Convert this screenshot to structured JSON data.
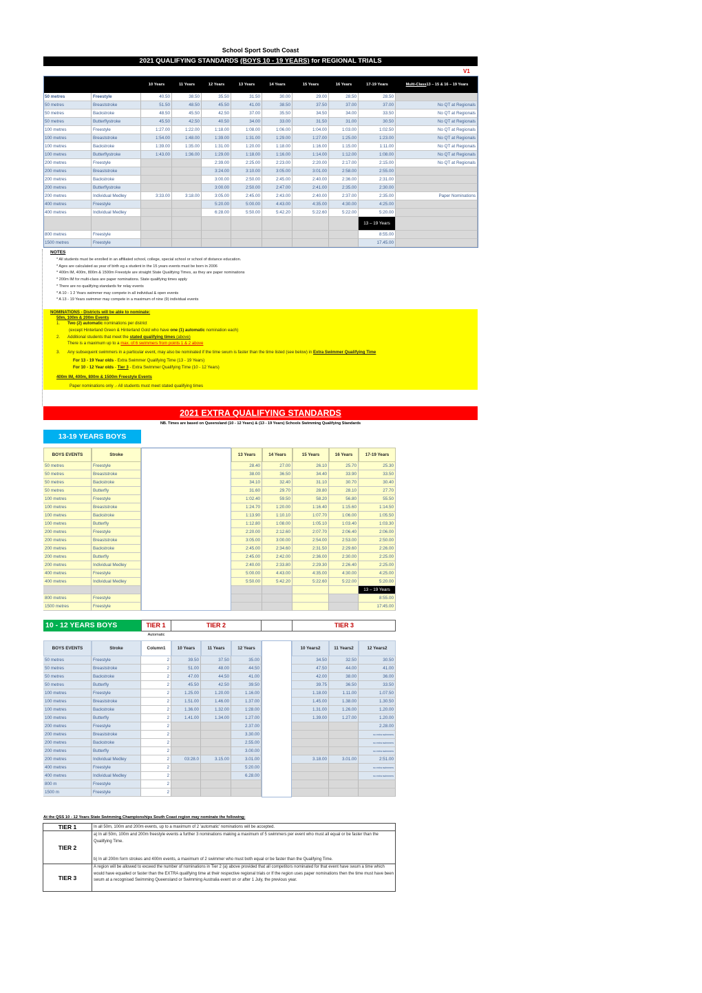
{
  "header": {
    "org": "School Sport South Coast",
    "title_pre": "2021  QUALIFYING STANDARDS ",
    "title_u": "(BOYS 10 - 19 YEARS)",
    "title_post": " for REGIONAL TRIALS",
    "version": "V1"
  },
  "t1": {
    "headers": [
      "",
      "",
      "10 Years",
      "11 Years",
      "12 Years",
      "13 Years",
      "14 Years",
      "15 Years",
      "16 Years",
      "17-19 Years"
    ],
    "multi_u": "Multi-Class",
    "multi_rest": "  13 – 15 & 16 – 19 Years",
    "rows": [
      [
        "50 metres",
        "Freestyle",
        "40.50",
        "38.50",
        "35.50",
        "31.50",
        "30.00",
        "29.00",
        "28.50",
        "28.50",
        null
      ],
      [
        "50 metres",
        "Breaststroke",
        "51.50",
        "48.50",
        "45.50",
        "41.00",
        "38.50",
        "37.50",
        "37.00",
        "37.00",
        "No QT at Regionals"
      ],
      [
        "50 metres",
        "Backstroke",
        "48.50",
        "45.50",
        "42.50",
        "37.00",
        "35.50",
        "34.50",
        "34.00",
        "33.50",
        "No QT at Regionals"
      ],
      [
        "50 metres",
        "Butterflystroke",
        "45.50",
        "42.50",
        "40.50",
        "34.00",
        "33.00",
        "31.50",
        "31.00",
        "30.50",
        "No QT at Regionals"
      ],
      [
        "100 metres",
        "Freestyle",
        "1:27.00",
        "1:22.00",
        "1:18.00",
        "1:08.00",
        "1:06.00",
        "1:04.00",
        "1:03.00",
        "1:02.50",
        "No QT at Regionals"
      ],
      [
        "100 metres",
        "Breaststroke",
        "1:54.00",
        "1:48.00",
        "1:39.00",
        "1:31.00",
        "1:29.00",
        "1:27.00",
        "1:25.00",
        "1:23.00",
        "No QT at Regionals"
      ],
      [
        "100 metres",
        "Backstroke",
        "1:39.00",
        "1:35.00",
        "1:31.00",
        "1:20.00",
        "1:18.00",
        "1:16.00",
        "1:15.00",
        "1:11.00",
        "No QT at Regionals"
      ],
      [
        "100 metres",
        "Butterflystroke",
        "1:43.00",
        "1:36.00",
        "1:29.00",
        "1:18.00",
        "1:16.00",
        "1:14.00",
        "1:12.00",
        "1:08.00",
        "No QT at Regionals"
      ],
      [
        "200 metres",
        "Freestyle",
        null,
        null,
        "2:39.00",
        "2:25.00",
        "2:23.00",
        "2:20.00",
        "2:17.00",
        "2:15.00",
        "No QT at Regionals"
      ],
      [
        "200 metres",
        "Breaststroke",
        null,
        null,
        "3:24.00",
        "3:10.00",
        "3:05.00",
        "3:01.00",
        "2:58.00",
        "2:55.00",
        null
      ],
      [
        "200 metres",
        "Backstroke",
        null,
        null,
        "3:00.00",
        "2:50.00",
        "2:45.00",
        "2:40.00",
        "2:36.00",
        "2:31.00",
        null
      ],
      [
        "200 metres",
        "Butterflystroke",
        null,
        null,
        "3:00.00",
        "2:50.00",
        "2:47.00",
        "2:41.00",
        "2:35.00",
        "2:30.00",
        null
      ],
      [
        "200 metres",
        "Individual Medley",
        "3:33.00",
        "3:18.00",
        "3:05.00",
        "2:45.00",
        "2:43.00",
        "2:40.00",
        "2:37.00",
        "2:35.00",
        "Paper Nominations"
      ],
      [
        "400 metres",
        "Freestyle",
        null,
        null,
        "5:20.00",
        "5:00.00",
        "4:43.00",
        "4:35.00",
        "4:30.00",
        "4:25.00",
        null
      ],
      [
        "400 metres",
        "Individual Medley",
        null,
        null,
        "6:28.00",
        "5:50.00",
        "5:42.20",
        "5:22.60",
        "5:22.00",
        "5:20.00",
        null
      ],
      [
        null,
        null,
        null,
        null,
        null,
        null,
        null,
        null,
        null,
        "13 – 19 Years",
        null
      ],
      [
        "800 metres",
        "Freestyle",
        null,
        null,
        null,
        null,
        null,
        null,
        null,
        "8:55.00",
        null
      ],
      [
        "1500 metres",
        "Freestyle",
        null,
        null,
        null,
        null,
        null,
        null,
        null,
        "17.45.00",
        null
      ]
    ]
  },
  "notes": {
    "title": "NOTES",
    "items": [
      "* All students must be enrolled in an affiliated school, college, special school or school of distance education.",
      "* Ages are calculated as year of birth eg a student in the 15 years events must be born in 2006",
      "* 400m IM, 400m, 800m & 1500m Freestyle are straight State Qualifying Times, as they are paper nominations",
      "* 200m IM for multi-class are paper nominations. State qualifying times apply",
      "* There are no qualifying standards for relay events",
      "* A 10 - 1 2 Years swimmer may compete in all individual & open events",
      "* A 13 - 19 Years swimmer may compete in a maximum of nine (9) individual events"
    ]
  },
  "nominations": {
    "title": "NOMINATIONS - Districts will be able to nominate:",
    "sub1": "50m, 100m & 200m Events",
    "p1_num": "1.",
    "p1_b": "Two (2)  automatic",
    "p1_rest": " nominations per district",
    "p1b_a": "(except Hinterland Green & Hinterland Gold who have ",
    "p1b_b": "one (1)  automatic",
    "p1b_c": " nomination each)",
    "p2_num": "2.",
    "p2_a": "Additional students that meet the ",
    "p2_b": "stated qualifying times",
    "p2_c": " (above)",
    "p2b_a": "There is a maximum up to a ",
    "p2b_red": "max. of 6 swimmers from points 1 & 2 above",
    "p3_num": "3.",
    "p3_a": "Any subsequent swimmers in a particular event, may also be nominated if the time swum is faster than the time listed (see below) in ",
    "p3_b": "Extra Swimmer Qualifying Time",
    "l13_b": "For 13 - 19 Year olds",
    "l13_rest": "  - Extra Swimmer Qualifying Time  (13 - 19 Years)",
    "l10_b": "For 10 - 12 Year olds",
    "l10_mid": "  - ",
    "l10_tier": "Tier 3",
    "l10_rest": " - Extra Swimmer Qualifying Time  (10 - 12 Years)",
    "sub2": "400m IM, 400m, 800m & 1500m Freestyle Events",
    "paper": "Paper nominations only .-   All students must meet stated qualifying times"
  },
  "extra": {
    "banner": "2021 EXTRA QUALIFYING STANDARDS",
    "nb": "NB. Times are based on Queensland (10 - 12 Years) & (13 - 19 Years) Schools Swimming Qualifying Standards"
  },
  "t2": {
    "label": "13-19 YEARS BOYS",
    "headers": [
      "BOYS EVENTS",
      "Stroke",
      "13 Years",
      "14 Years",
      "15 Years",
      "16 Years",
      "17-19 Years"
    ],
    "rows": [
      [
        "50 metres",
        "Freestyle",
        "28.40",
        "27.00",
        "26.10",
        "25.70",
        "25.30"
      ],
      [
        "50 metres",
        "Breaststroke",
        "38.00",
        "36.50",
        "34.40",
        "33.90",
        "33.50"
      ],
      [
        "50 metres",
        "Backstroke",
        "34.10",
        "32.40",
        "31.10",
        "30.70",
        "30.40"
      ],
      [
        "50 metres",
        "Butterfly",
        "31.60",
        "29.70",
        "28.80",
        "28.10",
        "27.70"
      ],
      [
        "100 metres",
        "Freestyle",
        "1:02.40",
        "59.50",
        "58.20",
        "56.80",
        "55.50"
      ],
      [
        "100 metres",
        "Breaststroke",
        "1:24.70",
        "1:20.00",
        "1:16.40",
        "1:15.60",
        "1:14.50"
      ],
      [
        "100 metres",
        "Backstroke",
        "1:13.90",
        "1:10.10",
        "1:07.70",
        "1:06.00",
        "1:05.50"
      ],
      [
        "100 metres",
        "Butterfly",
        "1:12.80",
        "1:08.00",
        "1:05.10",
        "1:03.40",
        "1:03.30"
      ],
      [
        "200 metres",
        "Freestyle",
        "2:20.00",
        "2:12.60",
        "2:07.70",
        "2:06.40",
        "2:06.00"
      ],
      [
        "200 metres",
        "Breaststroke",
        "3:05.00",
        "3:00.00",
        "2:54.00",
        "2:53.00",
        "2:50.00"
      ],
      [
        "200 metres",
        "Backstroke",
        "2:45.00",
        "2:34.60",
        "2:31.50",
        "2:29.60",
        "2:26.00"
      ],
      [
        "200 metres",
        "Butterfly",
        "2:45.00",
        "2:42.00",
        "2:36.00",
        "2:30.00",
        "2:25.00"
      ],
      [
        "200 metres",
        "Individual Medley",
        "2:40.00",
        "2:33.80",
        "2:29.30",
        "2:26.40",
        "2:25.00"
      ],
      [
        "400 metres",
        "Freestyle",
        "5:00.00",
        "4:43.00",
        "4:35.00",
        "4:30.00",
        "4:25.00"
      ],
      [
        "400 metres",
        "Individual Medley",
        "5:50.00",
        "5:42.20",
        "5:22.60",
        "5:22.00",
        "5:20.00"
      ],
      [
        null,
        null,
        null,
        null,
        "",
        "",
        "13 – 19 Years"
      ],
      [
        "800 metres",
        "Freestyle",
        null,
        null,
        "",
        null,
        "8:55.00"
      ],
      [
        "1500 metres",
        "Freestyle",
        null,
        null,
        "",
        null,
        "17:45.00"
      ]
    ]
  },
  "t3": {
    "label": "10 - 12 YEARS BOYS",
    "tier1": "TIER 1",
    "tier2": "TIER 2",
    "tier3": "TIER 3",
    "automatic": "Automatic",
    "headers": [
      "BOYS EVENTS",
      "Stroke",
      "Column1",
      "10 Years",
      "11 Years",
      "12 Years",
      "10 Years2",
      "11 Years2",
      "12 Years2"
    ],
    "rows": [
      [
        "50 metres",
        "Freestyle",
        "2",
        "39.50",
        "37.50",
        "35.00",
        "34.50",
        "32.50",
        "30.50"
      ],
      [
        "50 metres",
        "Breaststroke",
        "2",
        "51.00",
        "48.00",
        "44.50",
        "47.50",
        "44.00",
        "41.00"
      ],
      [
        "50 metres",
        "Backstroke",
        "2",
        "47.00",
        "44.50",
        "41.00",
        "42.00",
        "38.00",
        "36.00"
      ],
      [
        "50 metres",
        "Butterfly",
        "2",
        "45.50",
        "42.50",
        "39.50",
        "39.75",
        "36.50",
        "33.50"
      ],
      [
        "100 metres",
        "Freestyle",
        "2",
        "1.25.00",
        "1.20.00",
        "1.16.00",
        "1.18.00",
        "1.11.00",
        "1.07.50"
      ],
      [
        "100 metres",
        "Breaststroke",
        "2",
        "1.51.00",
        "1.46.00",
        "1.37.00",
        "1.45.00",
        "1.38.00",
        "1.30.50"
      ],
      [
        "100 metres",
        "Backstroke",
        "2",
        "1.36.00",
        "1.32.00",
        "1:28.00",
        "1.31.00",
        "1.26.00",
        "1.20.00"
      ],
      [
        "100 metres",
        "Butterfly",
        "2",
        "1.41.00",
        "1.34.00",
        "1.27.00",
        "1.39.00",
        "1.27.00",
        "1.20.00"
      ],
      [
        "200 metres",
        "Freestyle",
        "2",
        null,
        null,
        "2.37.00",
        null,
        null,
        "2.28.00"
      ],
      [
        "200 metres",
        "Breaststroke",
        "2",
        null,
        null,
        "3.30.00",
        null,
        null,
        "no extra swimmers"
      ],
      [
        "200 metres",
        "Backstroke",
        "2",
        null,
        null,
        "2.55.00",
        null,
        null,
        "no extra swimmers"
      ],
      [
        "200 metres",
        "Butterfly",
        "2",
        null,
        null,
        "3.00.00",
        null,
        null,
        "no extra swimmers"
      ],
      [
        "200 metres",
        "Individual Medley",
        "2",
        "03:28.0",
        "3.15.00",
        "3.01.00",
        "3.18.00",
        "3.01.00",
        "2:51.00"
      ],
      [
        "400 metres",
        "Freestyle",
        "2",
        null,
        null,
        "5:20.00",
        null,
        null,
        "no extra swimmers"
      ],
      [
        "400 metres",
        "Individual Medley",
        "2",
        null,
        null,
        "6.28.00",
        null,
        null,
        "no extra swimmers"
      ],
      [
        "800 m",
        "Freestyle",
        "2",
        null,
        null,
        null,
        null,
        null,
        null
      ],
      [
        "1500 m",
        "Freestyle",
        "2",
        null,
        null,
        null,
        null,
        null,
        null
      ]
    ]
  },
  "tiers": {
    "heading": "At the QSS 10 - 12 Years State Swimming Championships South Coast region may nominate the following:",
    "rows": [
      {
        "label": "TIER 1",
        "text": "In all 50m, 100m and 200m events, up to a maximum of 2 'automatic' nominations will be accepted."
      },
      {
        "label": "TIER 2",
        "text": "a) In all 50m, 100m and 200m freestyle events a further 3 nominations making a maximum of 5 swimmers per event who must all equal or be faster than the Qualifying Time.",
        "text2": "b) In all 200m form strokes and 400m events, a maximum of 2 swimmer who must both equal or be faster than the Qualifying Time."
      },
      {
        "label": "TIER 3",
        "text": "A region will be allowed to exceed the number of nominations in Tier 2 (a) above provided that all competitors nominated for that event have swum a time which would have equalled or faster than the EXTRA qualifying time at their respective regional trials or  If the region uses paper nominations then the time must have been swum at a recognised Swimming Queensland or Swimming Australia event on or after 1 July, the previous year."
      }
    ]
  },
  "colors": {
    "header_black": "#000000",
    "version_red": "#e00000",
    "row_blue": "#dce6f1",
    "gray": "#d9d9d9",
    "yellow_notice": "#ffff00",
    "banner_red": "#ff0000",
    "cyan_label": "#00b0f0",
    "green_label": "#00b050",
    "pale_yellow": "#ffffcc",
    "tier_red": "#c00000"
  }
}
